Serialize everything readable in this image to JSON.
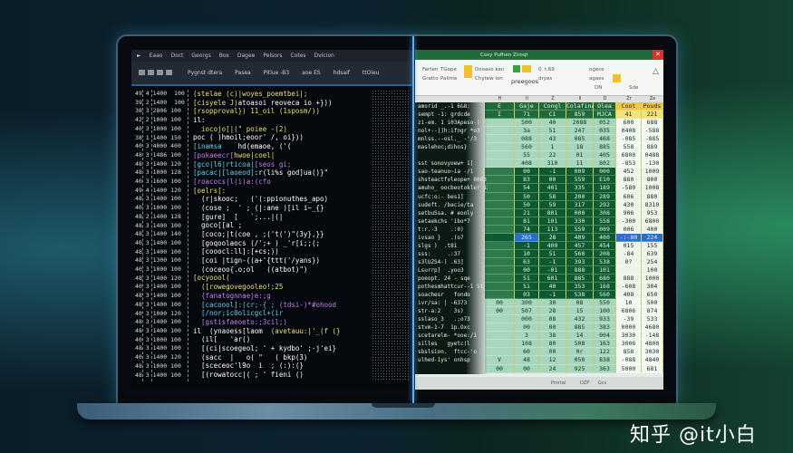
{
  "editor": {
    "menu": [
      "Eaao",
      "Doct",
      "Georgs",
      "Box",
      "Dagee",
      "Pelsors",
      "Cotes",
      "Dvicion"
    ],
    "ribbon": [
      "Pygnst dtera",
      "Pasea",
      "Pitlue -B3",
      "aoe ES",
      "hdsaif",
      "ttOieu"
    ],
    "gutter": [
      "49 4 1400  100",
      "39 2 1400  100",
      "38 3 2806 100",
      "42 2 1000 100",
      "40 3 1000 100",
      "38 1 1400 150",
      "40 3 4000 400",
      "48 3 1486 100",
      "48 3 1400 120",
      "48 3 1000 128",
      "40 3 1600 100",
      "49 4 1400 120",
      "48 3 1400 100",
      "40 3 1000 100",
      "48 2 1400 128",
      "48 3 1400 100",
      "48 3 1400 140",
      "40 3 1400 100",
      "48 3 1400 100",
      "48 3 1300 100",
      "40 3 1000 100",
      "48 3 1400 120",
      "40 3 1400 100",
      "48 3 1400 100",
      "48 3 1400 100",
      "40 3 1000 120",
      "48 3 1400 100",
      "48 3 1400 100",
      "40 3 1000 100",
      "48 3 1400 100",
      "40 3 1400 120",
      "48 3 1000 100",
      "48 3 1400 100"
    ],
    "code": [
      [
        [
          "(stelae (c)|woyes_poemtbei|;",
          "#e8e070"
        ]
      ],
      [
        [
          "[cisyele J)",
          "#e8e070"
        ],
        [
          "atoasoi reoveca io +}))",
          "#ffffff"
        ]
      ],
      [
        [
          "[rsopproval}) 11_oil (1sposm/))",
          "#e8e070"
        ]
      ],
      [
        [
          "il:",
          "#ffffff"
        ]
      ],
      [
        [
          "  iocojo[|(\" poiee -(2)",
          "#e8e070"
        ]
      ],
      [
        [
          "poc ( )",
          "#ffffff"
        ],
        [
          "hmoil;eoor' /, oi}))",
          "#ffffff"
        ]
      ],
      [
        [
          "[inamsa  ",
          "#60d0f0"
        ],
        [
          "  hd(emaoe, ('(",
          "#ffffff"
        ]
      ],
      [
        [
          "[pokaeecr[",
          "#c080f0"
        ],
        [
          "hwoe|coel|",
          "#e8e070"
        ]
      ],
      [
        [
          "[gco|l6|rticoa|",
          "#60d0f0"
        ],
        [
          "[seos gi;",
          "#c080f0"
        ]
      ],
      [
        [
          "[pacac|[laoeod]",
          "#60d0f0"
        ],
        [
          ":r(li%s god]ua()}\"",
          "#ffffff"
        ]
      ],
      [
        [
          "[roacocs|l(i)a:(cfo",
          "#c080f0"
        ]
      ],
      [
        [
          "[oelrs[:",
          "#e8e070"
        ]
      ],
      [
        [
          "  (r|skooc;   ('(:ppionuthes_apo)",
          "#ffffff"
        ]
      ],
      [
        [
          "  (cose ;  ' ; (|:ane )[il i~_{}",
          "#ffffff"
        ]
      ],
      [
        [
          "  [gure]  [   `;...|(|",
          "#ffffff"
        ]
      ],
      [
        [
          "  goco[[al ;",
          "#ffffff"
        ]
      ],
      [
        [
          "  [coco;|t(coe , ;('t(')\"(3y},}}",
          "#ffffff"
        ]
      ],
      [
        [
          "  [goqoolaocs (/';+ ) _'r[i;;(;",
          "#ffffff"
        ]
      ],
      [
        [
          "  [cooocl:ll]:[+cs;))",
          "#ffffff"
        ]
      ],
      [
        [
          "  [coi |tign-((a+'{ttt('/yans})",
          "#ffffff"
        ]
      ],
      [
        [
          "  (coceoo{.o;ol   ((atbot)\")",
          "#ffffff"
        ]
      ],
      [
        [
          "[ocyoool(",
          "#e8e070"
        ]
      ],
      [
        [
          "  ([rowegovegooleo!;25",
          "#e8e070"
        ]
      ],
      [
        [
          "  {fanatognnaeje:;g",
          "#c080f0"
        ]
      ],
      [
        [
          "  [cacoool]:(cr;-{ ;",
          "#60d0f0"
        ],
        [
          " (tdsi-)*#ohood",
          "#c080f0"
        ]
      ],
      [
        [
          "  [/nor;ic0olicgcl+(ir",
          "#60d0f0"
        ]
      ],
      [
        [
          "  [gstisfaeoeto:;3cil;)",
          "#c080f0"
        ]
      ],
      [
        [
          "il  (ynaoess[laom ",
          "#ffffff"
        ],
        [
          " (avetauu:|'_(f (}",
          "#e8e070"
        ]
      ],
      [
        [
          "  (il[   'ar()",
          "#ffffff"
        ]
      ],
      [
        [
          "  [(ci|scoegeol; ' + kydbo' ;-j'ei}",
          "#ffffff"
        ]
      ],
      [
        [
          "  (sacc  |   o( \"   ( bkp(3)",
          "#ffffff"
        ]
      ],
      [
        [
          "  [sceceoc'l9o  i  ; (:):(}",
          "#ffffff"
        ]
      ],
      [
        [
          "  [(rowatocc|( ; ' fieni ()",
          "#ffffff"
        ]
      ]
    ]
  },
  "sheet": {
    "title": "Coxy Pufhen Ziroqt",
    "ribbon": [
      "Farten",
      "Gratto",
      "TGope",
      "Palime",
      "Dooaso kan",
      "Chytew ion",
      "preegoos",
      "0. t.69",
      "dryes",
      "ogece",
      "agaes",
      "DN",
      "Sde"
    ],
    "col_letters": [
      "",
      "H",
      "II",
      "Z",
      "II",
      "D",
      "Zr",
      "Ze"
    ],
    "headers": [
      "E",
      "Gaje",
      "Congl",
      "Colafina",
      "Olea",
      "Coot",
      "Pouds"
    ],
    "rows": [
      {
        "tone": "hdr2",
        "v": [
          "I",
          "71",
          "C1",
          "859",
          "MJCA",
          "41",
          "221"
        ]
      },
      {
        "tone": "light",
        "v": [
          "",
          "500",
          "40",
          "2088",
          "052",
          "600",
          "688"
        ]
      },
      {
        "tone": "light",
        "v": [
          "",
          "3a",
          "51",
          "247",
          "035",
          "0408",
          "-588"
        ]
      },
      {
        "tone": "light",
        "v": [
          "",
          "088",
          "43",
          "085",
          "468",
          "-085",
          "-885"
        ]
      },
      {
        "tone": "light",
        "v": [
          "",
          "560",
          "1",
          "18",
          "885",
          "558",
          "889"
        ]
      },
      {
        "tone": "light",
        "v": [
          "",
          "55",
          "22",
          "01",
          "405",
          "6800",
          "0488"
        ]
      },
      {
        "tone": "light",
        "v": [
          "",
          "408",
          "310",
          "11",
          "802",
          "-853",
          "-130"
        ]
      },
      {
        "tone": "dark",
        "v": [
          "",
          "00",
          "-1",
          "009",
          "000",
          "452",
          "1009"
        ]
      },
      {
        "tone": "dark",
        "v": [
          "",
          "83",
          "00",
          "559",
          "E10",
          "880",
          "800"
        ]
      },
      {
        "tone": "dark",
        "v": [
          "",
          "54",
          "401",
          "335",
          "189",
          "-580",
          "1008"
        ]
      },
      {
        "tone": "dark",
        "v": [
          "",
          "50",
          "58",
          "200",
          "289",
          "606",
          "880"
        ]
      },
      {
        "tone": "dark",
        "v": [
          "",
          "50",
          "59",
          "317",
          "292",
          "430",
          "8310"
        ]
      },
      {
        "tone": "dark",
        "v": [
          "",
          "21",
          "801",
          "000",
          "308",
          "906",
          "953"
        ]
      },
      {
        "tone": "dark",
        "v": [
          "",
          "81",
          "101",
          "330",
          "558",
          "-300",
          "6800"
        ]
      },
      {
        "tone": "dark",
        "v": [
          "",
          "74",
          "113",
          "559",
          "009",
          "006",
          "400"
        ]
      },
      {
        "tone": "blue",
        "v": [
          "",
          "265",
          "28",
          "409",
          "400",
          "-:-80",
          "224"
        ]
      },
      {
        "tone": "dark",
        "v": [
          "",
          "-1",
          "400",
          "457",
          "454",
          "015",
          "155"
        ]
      },
      {
        "tone": "dark",
        "v": [
          "",
          "10",
          "51",
          "560",
          "208",
          "-84",
          "639"
        ]
      },
      {
        "tone": "dark",
        "v": [
          "",
          "63",
          "-1",
          "393",
          "538",
          "0?",
          "254"
        ]
      },
      {
        "tone": "dark",
        "v": [
          "",
          "00",
          "-01",
          "888",
          "101",
          "",
          "100"
        ]
      },
      {
        "tone": "dark",
        "v": [
          "",
          "51",
          "601",
          "885",
          "680",
          "888",
          "1000"
        ]
      },
      {
        "tone": "dark",
        "v": [
          "",
          "51",
          "40",
          "353",
          "168",
          "-608",
          "304"
        ]
      },
      {
        "tone": "dark",
        "v": [
          "",
          "03",
          "-1",
          "538",
          "560",
          "408",
          "650"
        ]
      },
      {
        "tone": "light",
        "v": [
          "00",
          "300",
          "30",
          "08",
          "550",
          "10",
          "500"
        ]
      },
      {
        "tone": "light",
        "v": [
          "00",
          "507",
          "28",
          "15",
          "100",
          "6806",
          "874"
        ]
      },
      {
        "tone": "light",
        "v": [
          "",
          "000",
          "08",
          "432",
          "933",
          "-39",
          "533"
        ]
      },
      {
        "tone": "light",
        "v": [
          "",
          "00",
          "00",
          "885",
          "383",
          "0000",
          "4680"
        ]
      },
      {
        "tone": "light",
        "v": [
          "",
          "3",
          "38",
          "14",
          "004",
          "3030",
          "-148"
        ]
      },
      {
        "tone": "light",
        "v": [
          "",
          "108",
          "80",
          "508",
          "163",
          "3006",
          "4800"
        ]
      },
      {
        "tone": "light",
        "v": [
          "",
          "60",
          "00",
          "0r",
          "122",
          "858",
          "3030"
        ]
      },
      {
        "tone": "light",
        "v": [
          "V",
          "48",
          "12",
          "050",
          "838",
          "-088",
          "4840"
        ]
      },
      {
        "tone": "light",
        "v": [
          "00",
          "00",
          "24",
          "925",
          "363",
          "5000",
          "681"
        ]
      }
    ],
    "overlay": [
      "amorid _.-1 6&8:",
      "sempt -1: grdcde",
      "zi-em. 1 i03Apeso-)",
      "nol+--|]h:ifngr *o3",
      "mnlss.--osl._ -'/3",
      "maslehoc;dihos}",
      "",
      "sst sonovyoew+ i]",
      "sao-teanuo~ia -/1",
      "shsteactfvleope+ 0083",
      "amuho_ oocbeotokler 12",
      "ucfc:o:- bes1]",
      "sudeft. /bacie/ta",
      "setbuSsa. # eooly",
      "setaekchs 'ibo*7",
      "t:r.-3    .:0)",
      "ivsao }   .(o7",
      "slgs )  .t81",
      "sss:     .:37",
      "s3lUZS4-) .63]",
      "Lsurrp]  .yoo3",
      "poeopt. 24 - sqe",
      "pothesmhattcur--1 5t",
      "soachesr   fondo",
      "ivr/sa: | -6373",
      "str-a:2    3s)",
      "sslaso_3   .;o73",
      "stvm-1-7  1p.Oxc",
      "scetarelm- *ooe:/1",
      "silles   gyetc(l",
      "sbslsion.  ftcc-'o",
      "ulhed-1ys' onhsp"
    ],
    "status": [
      "Pmrtal",
      "DZP",
      "Gcv"
    ]
  },
  "watermark": "知乎 @it小白"
}
